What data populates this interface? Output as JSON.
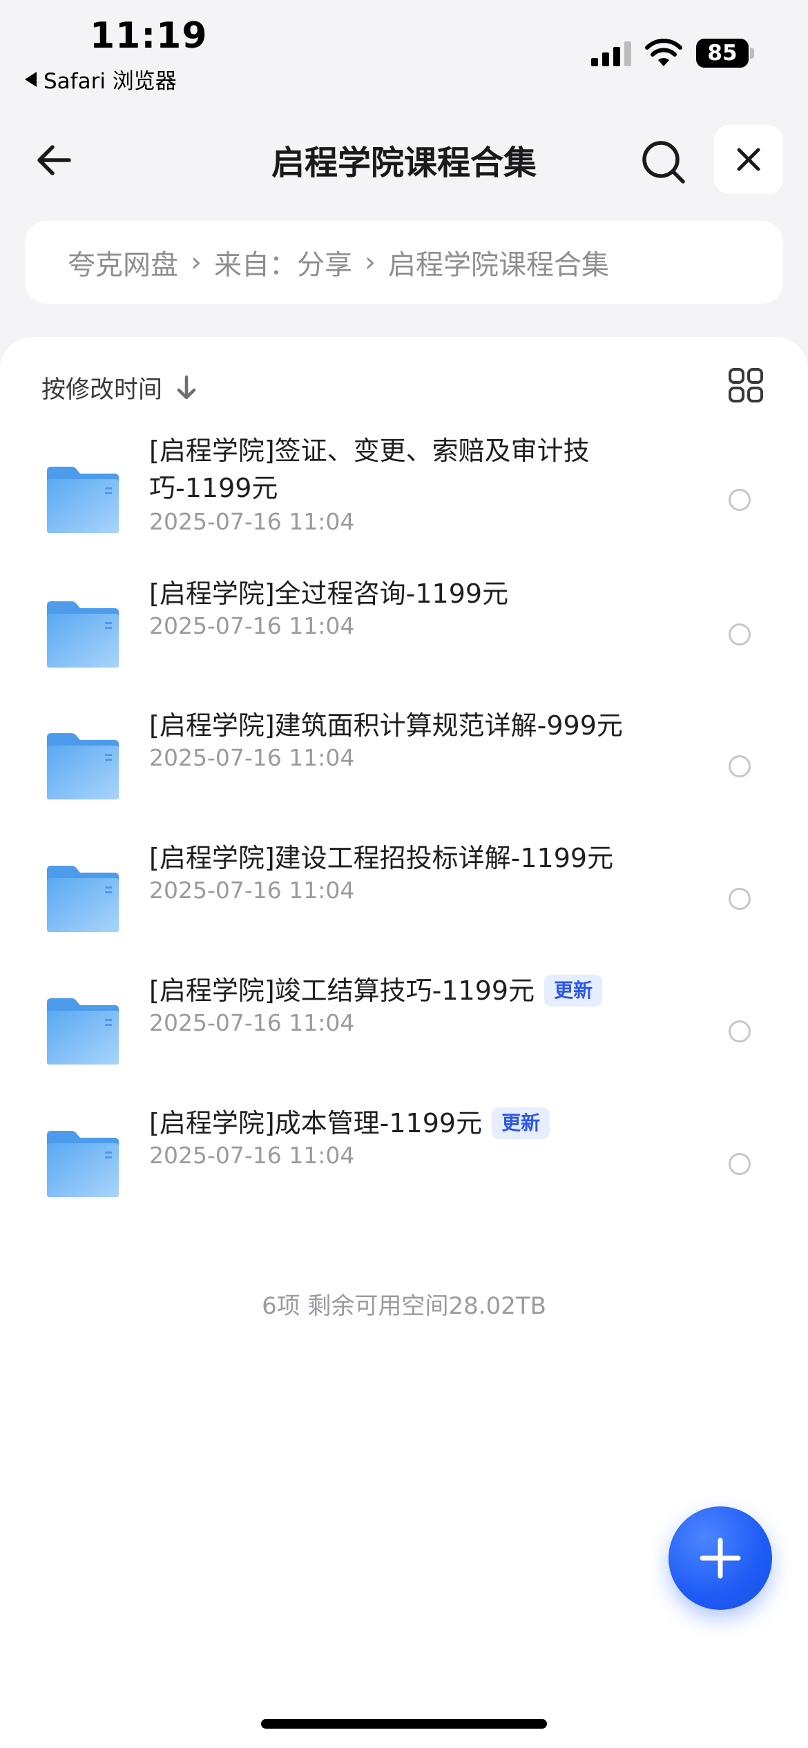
{
  "status_bar": {
    "time": "11:19",
    "back_app": "Safari 浏览器",
    "battery": "85"
  },
  "nav": {
    "title": "启程学院课程合集",
    "back_icon": "arrow-left-icon",
    "search_icon": "search-icon",
    "close_icon": "close-icon"
  },
  "breadcrumb": {
    "items": [
      "夸克网盘",
      "来自：分享",
      "启程学院课程合集"
    ]
  },
  "toolbar": {
    "sort_label": "按修改时间",
    "sort_icon": "arrow-down-icon",
    "view_icon": "grid-view-icon"
  },
  "files": [
    {
      "name": "[启程学院]签证、变更、索赔及审计技巧-1199元",
      "date": "2025-07-16 11:04",
      "badge": ""
    },
    {
      "name": "[启程学院]全过程咨询-1199元",
      "date": "2025-07-16 11:04",
      "badge": ""
    },
    {
      "name": "[启程学院]建筑面积计算规范详解-999元",
      "date": "2025-07-16 11:04",
      "badge": ""
    },
    {
      "name": "[启程学院]建设工程招投标详解-1199元",
      "date": "2025-07-16 11:04",
      "badge": ""
    },
    {
      "name": "[启程学院]竣工结算技巧-1199元",
      "date": "2025-07-16 11:04",
      "badge": "更新"
    },
    {
      "name": "[启程学院]成本管理-1199元",
      "date": "2025-07-16 11:04",
      "badge": "更新"
    }
  ],
  "summary": "6项 剩余可用空间28.02TB",
  "fab_icon": "plus-icon",
  "colors": {
    "accent": "#1E5BF5",
    "badge_bg": "#E6EDFF",
    "badge_text": "#2B58E8",
    "folder": "#6FB6F5",
    "background": "#F4F4F6"
  }
}
